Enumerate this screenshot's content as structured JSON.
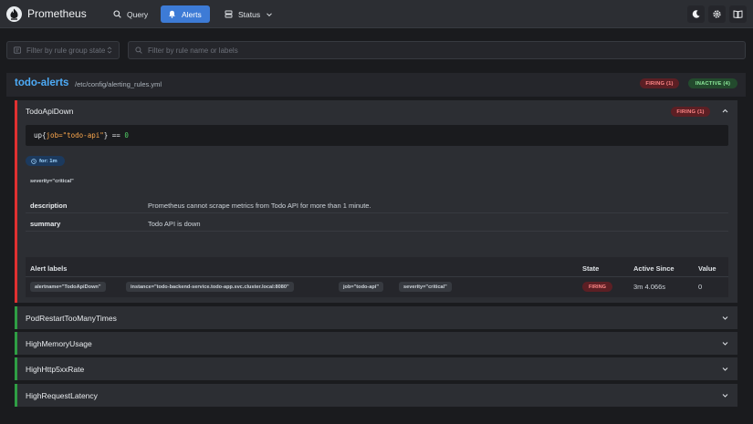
{
  "app": {
    "title": "Prometheus"
  },
  "nav": {
    "query": "Query",
    "alerts": "Alerts",
    "status": "Status"
  },
  "filters": {
    "state_placeholder": "Filter by rule group state",
    "search_placeholder": "Filter by rule name or labels"
  },
  "group": {
    "name": "todo-alerts",
    "file": "/etc/config/alerting_rules.yml",
    "firing_count": "FIRING (1)",
    "inactive_count": "INACTIVE (4)"
  },
  "rule": {
    "name": "TodoApiDown",
    "state_badge": "FIRING (1)",
    "expr_metric": "up",
    "expr_label": "job=\"todo-api\"",
    "expr_op": " == ",
    "expr_value": "0",
    "for": "for: 1m",
    "severity": "severity=\"critical\"",
    "annotations": [
      {
        "key": "description",
        "value": "Prometheus cannot scrape metrics from Todo API for more than 1 minute."
      },
      {
        "key": "summary",
        "value": "Todo API is down"
      }
    ]
  },
  "alerts_table": {
    "headers": {
      "labels": "Alert labels",
      "state": "State",
      "active_since": "Active Since",
      "value": "Value"
    },
    "row": {
      "labels": [
        "alertname=\"TodoApiDown\"",
        "instance=\"todo-backend-service.todo-app.svc.cluster.local:8080\"",
        "job=\"todo-api\"",
        "severity=\"critical\""
      ],
      "state": "FIRING",
      "active_since": "3m 4.066s",
      "value": "0"
    }
  },
  "other_rules": [
    "PodRestartTooManyTimes",
    "HighMemoryUsage",
    "HighHttp5xxRate",
    "HighRequestLatency"
  ],
  "icons": {
    "logo": "prometheus-flame-icon",
    "query": "search-icon",
    "alerts": "bell-icon",
    "status": "server-icon",
    "theme": "moon-icon",
    "settings": "gear-icon",
    "docs": "book-icon"
  },
  "colors": {
    "accent": "#3d7bd6",
    "firing": "#e03131",
    "inactive": "#2f9e44",
    "link": "#4dabf7"
  }
}
